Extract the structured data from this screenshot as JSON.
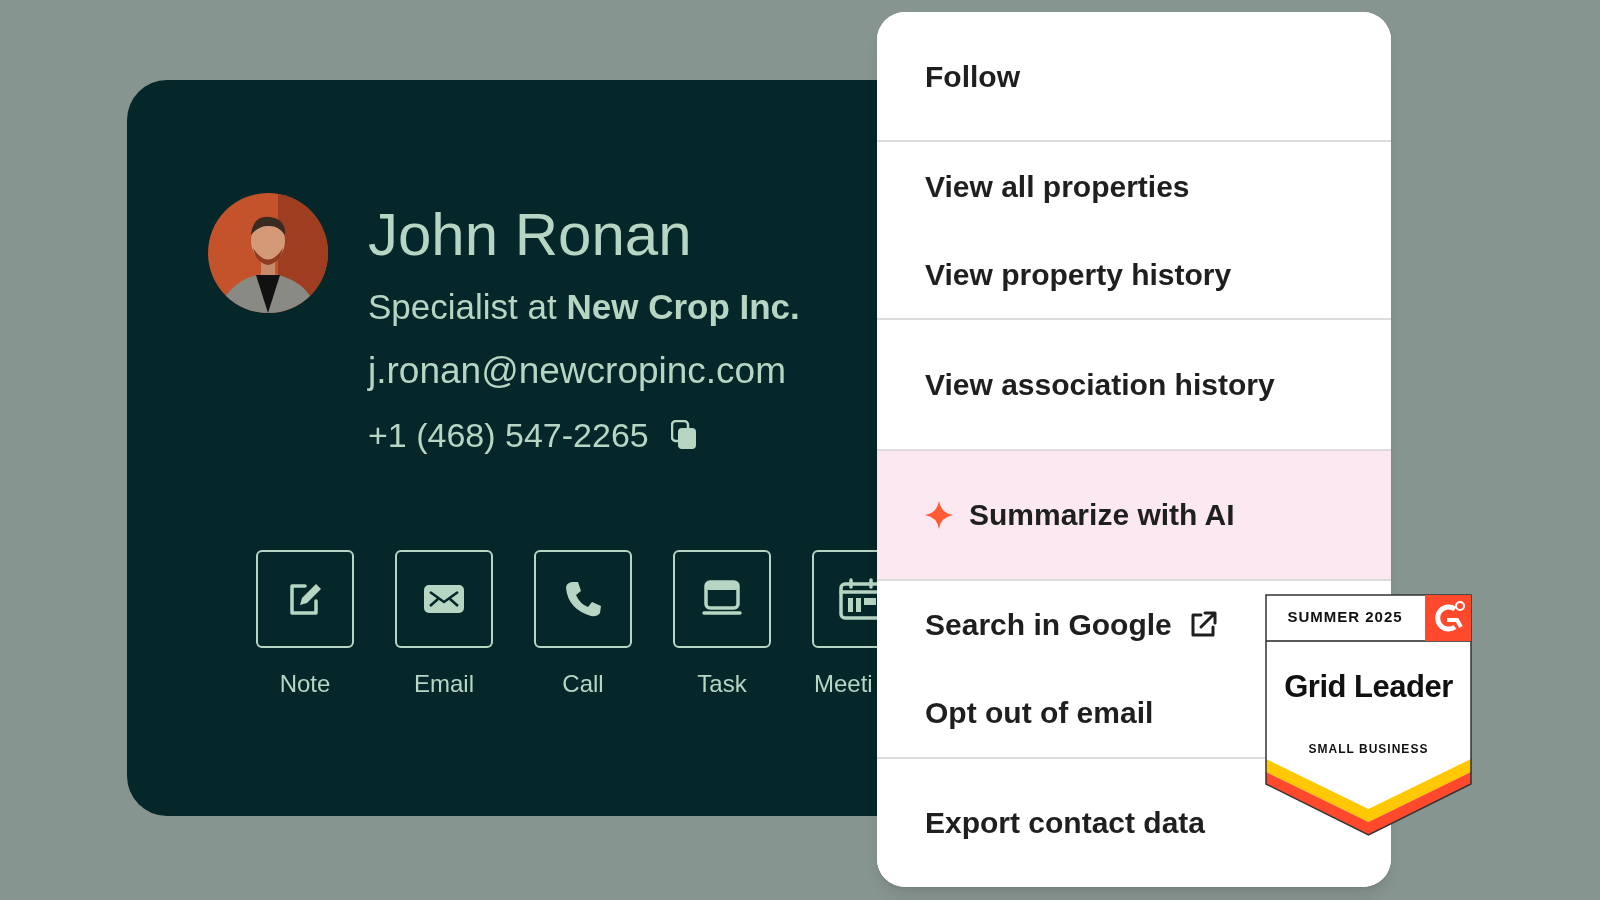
{
  "contact": {
    "name": "John Ronan",
    "role": "Specialist at **New Crop Inc.**",
    "email": "j.ronan@newcropinc.com",
    "phone": "+1 (468) 547-2265"
  },
  "actions": [
    {
      "kind": "note",
      "label": "Note"
    },
    {
      "kind": "email",
      "label": "Email"
    },
    {
      "kind": "call",
      "label": "Call"
    },
    {
      "kind": "task",
      "label": "Task"
    },
    {
      "kind": "meeting",
      "label": "Meeti"
    }
  ],
  "menu": {
    "sections": [
      {
        "highlighted": false,
        "items": [
          {
            "kind": "plain",
            "label": "Follow"
          }
        ]
      },
      {
        "highlighted": false,
        "items": [
          {
            "kind": "plain",
            "label": "View all properties"
          },
          {
            "kind": "plain",
            "label": "View property history"
          }
        ]
      },
      {
        "highlighted": false,
        "items": [
          {
            "kind": "plain",
            "label": "View association history"
          }
        ]
      },
      {
        "highlighted": true,
        "items": [
          {
            "kind": "ai",
            "label": "Summarize with AI"
          }
        ]
      },
      {
        "highlighted": false,
        "items": [
          {
            "kind": "external",
            "label": "Search in Google"
          },
          {
            "kind": "plain",
            "label": "Opt out of email"
          }
        ]
      },
      {
        "highlighted": false,
        "items": [
          {
            "kind": "plain",
            "label": "Export contact data"
          }
        ]
      }
    ]
  },
  "badge": {
    "season": "SUMMER 2025",
    "title": "Grid Leader",
    "segment": "SMALL BUSINESS"
  }
}
